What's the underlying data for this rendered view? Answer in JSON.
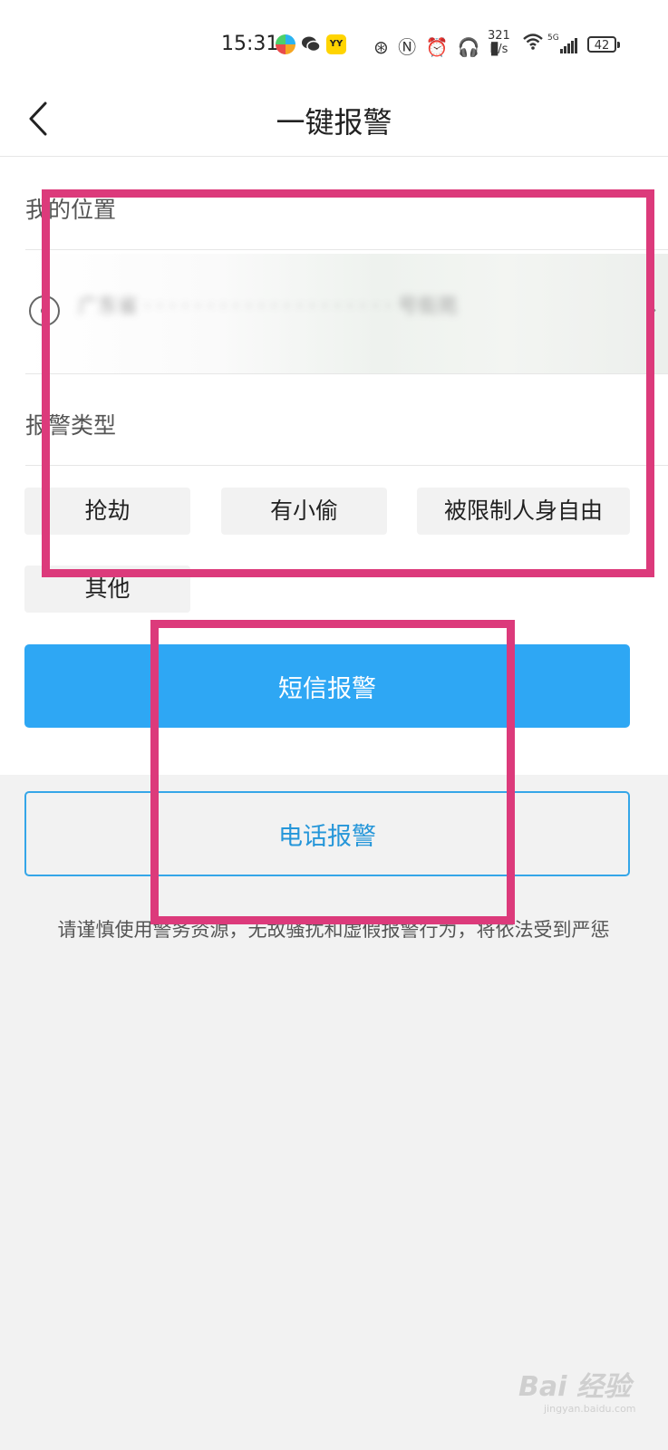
{
  "status_bar": {
    "time": "15:31",
    "net_speed_value": "321",
    "net_speed_unit": "B/s",
    "network": "5G",
    "battery": "42",
    "icons": [
      "baidu-app-icon",
      "wechat-icon",
      "yy-app-icon",
      "data-saver-icon",
      "nfc-icon",
      "alarm-icon",
      "headphones-icon",
      "battery-saver-icon",
      "wifi-icon",
      "cellular-signal-icon",
      "battery-icon"
    ]
  },
  "header": {
    "title": "一键报警",
    "back_icon": "chevron-left-icon"
  },
  "location": {
    "section_label": "我的位置",
    "address_text": "广东省 · · · · · · · · · · · · · · · · · · · · 号街苑",
    "icon": "location-target-icon"
  },
  "alarm_type": {
    "section_label": "报警类型",
    "options": [
      "抢劫",
      "有小偷",
      "被限制人身自由",
      "其他"
    ]
  },
  "actions": {
    "sms_label": "短信报警",
    "phone_label": "电话报警"
  },
  "notice": "请谨慎使用警务资源，无故骚扰和虚假报警行为，将依法受到严惩",
  "watermark": {
    "text": "Bai 经验",
    "sub": "jingyan.baidu.com"
  },
  "colors": {
    "primary": "#2ea7f4",
    "annotation": "#dc3a7b",
    "chip_bg": "#f2f2f2",
    "page_bg": "#f2f2f2"
  }
}
